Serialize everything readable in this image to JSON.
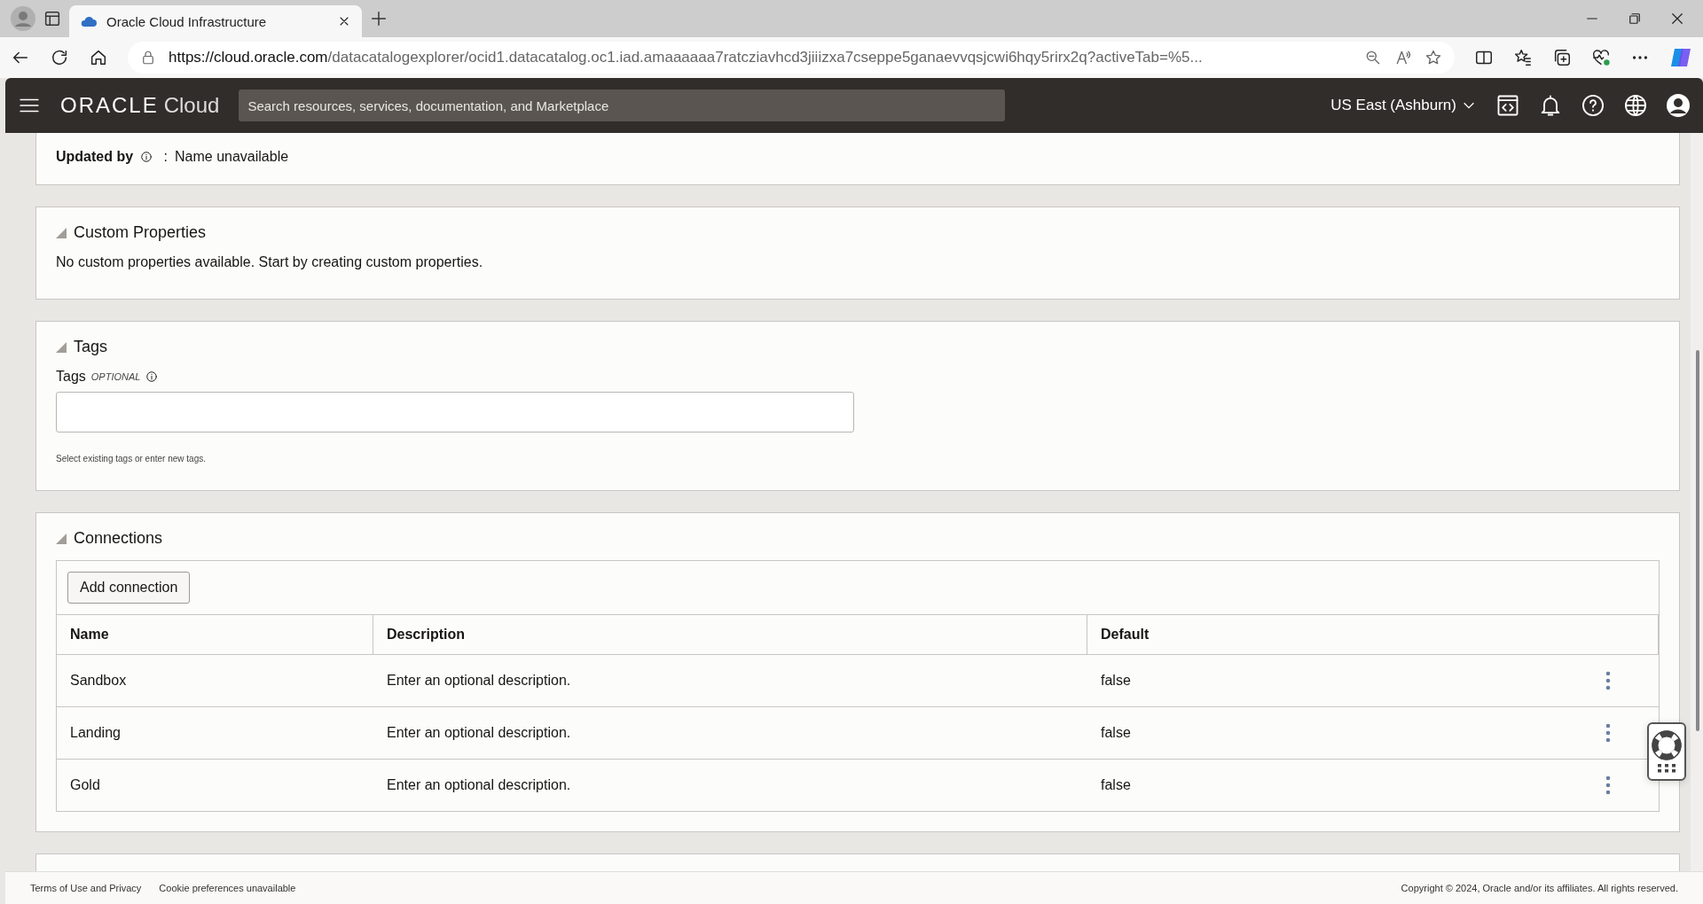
{
  "browser": {
    "tabs": [
      {
        "title": "Oracle Cloud Infrastructure",
        "selected": true
      }
    ],
    "url_host": "https://cloud.oracle.com",
    "url_path": "/datacatalogexplorer/ocid1.datacatalog.oc1.iad.amaaaaaa7ratcziavhcd3jiiizxa7cseppe5ganaevvqsjcwi6hqy5rirx2q?activeTab=%5..."
  },
  "header": {
    "logo_brand": "ORACLE",
    "logo_product": "Cloud",
    "search": {
      "placeholder": "Search resources, services, documentation, and Marketplace"
    },
    "region": "US East (Ashburn)"
  },
  "updated_by": {
    "label": "Updated by",
    "separator": ":",
    "value": "Name unavailable"
  },
  "custom_properties": {
    "title": "Custom Properties",
    "expanded": true,
    "message": "No custom properties available. Start by creating custom properties."
  },
  "tags": {
    "title": "Tags",
    "expanded": true,
    "field_label": "Tags",
    "optional": "OPTIONAL",
    "help": "Select existing tags or enter new tags."
  },
  "connections": {
    "title": "Connections",
    "expanded": true,
    "add_button": "Add connection",
    "columns": [
      "Name",
      "Description",
      "Default"
    ],
    "rows": [
      {
        "name": "Sandbox",
        "description": "Enter an optional description.",
        "default": "false"
      },
      {
        "name": "Landing",
        "description": "Enter an optional description.",
        "default": "false"
      },
      {
        "name": "Gold",
        "description": "Enter an optional description.",
        "default": "false"
      }
    ]
  },
  "footer": {
    "links": [
      "Terms of Use and Privacy",
      "Cookie preferences unavailable"
    ],
    "copyright": "Copyright © 2024, Oracle and/or its affiliates. All rights reserved."
  }
}
